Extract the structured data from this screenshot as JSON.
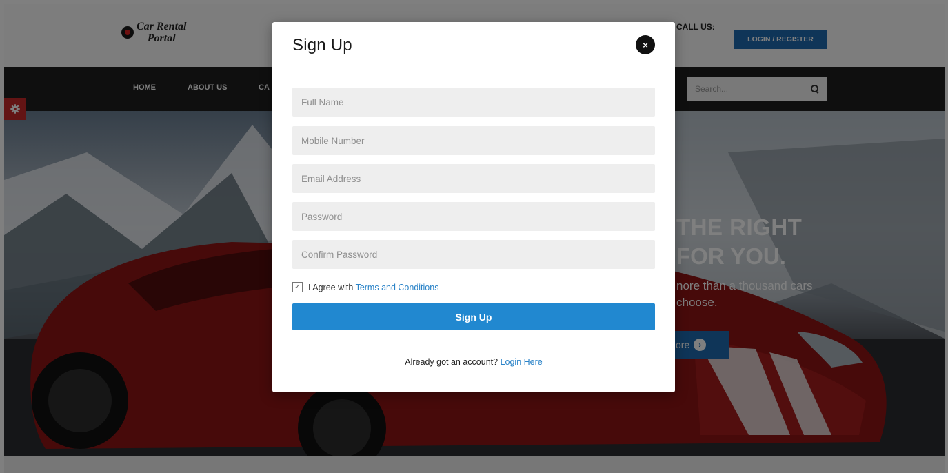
{
  "site": {
    "logo_line1": "Car Rental",
    "logo_line2": "Portal",
    "call_us": "CALL US:",
    "login_register": "LOGIN / REGISTER"
  },
  "nav": {
    "home": "HOME",
    "about": "ABOUT US",
    "partial": "CA",
    "search_placeholder": "Search..."
  },
  "hero": {
    "line1": "THE RIGHT",
    "line2": "FOR YOU.",
    "sub1": "nore than a thousand cars",
    "sub2": "choose.",
    "button": "ore"
  },
  "modal": {
    "title": "Sign Up",
    "close_glyph": "×",
    "fields": {
      "full_name": "Full Name",
      "mobile": "Mobile Number",
      "email": "Email Address",
      "password": "Password",
      "confirm": "Confirm Password"
    },
    "agree_prefix": "I Agree with ",
    "terms_link": "Terms and Conditions",
    "submit": "Sign Up",
    "already_text": "Already got an account? ",
    "login_link": "Login Here"
  },
  "colors": {
    "primary_button": "#2188d0",
    "link": "#2a83c8",
    "overlay": "rgba(0,0,0,0.5)"
  }
}
